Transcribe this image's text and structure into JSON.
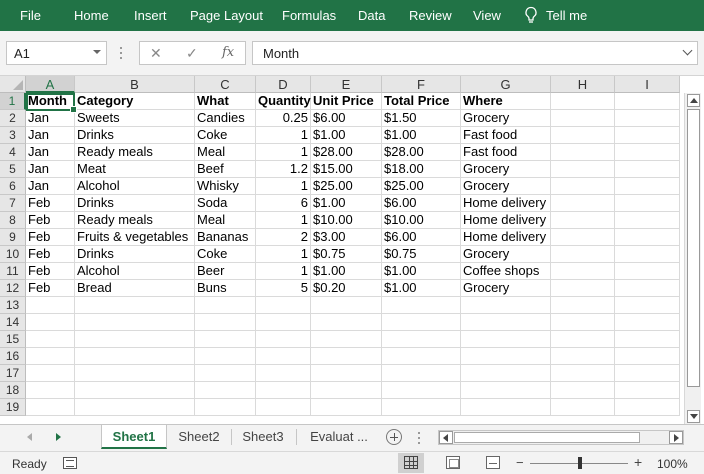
{
  "ribbon": {
    "tabs": [
      "File",
      "Home",
      "Insert",
      "Page Layout",
      "Formulas",
      "Data",
      "Review",
      "View"
    ],
    "tell_me": "Tell me",
    "color": "#217346"
  },
  "formula_bar": {
    "name_box": "A1",
    "cancel_icon": "✕",
    "enter_icon": "✓",
    "fx_label": "fx",
    "content": "Month"
  },
  "sheet": {
    "columns": [
      "A",
      "B",
      "C",
      "D",
      "E",
      "F",
      "G",
      "H",
      "I"
    ],
    "row_numbers": [
      "1",
      "2",
      "3",
      "4",
      "5",
      "6",
      "7",
      "8",
      "9",
      "10",
      "11",
      "12",
      "13",
      "14",
      "15",
      "16",
      "17",
      "18",
      "19"
    ],
    "header": [
      "Month",
      "Category",
      "What",
      "Quantity",
      "Unit Price",
      "Total Price",
      "Where"
    ],
    "rows": [
      [
        "Jan",
        "Sweets",
        "Candies",
        "0.25",
        "$6.00",
        "$1.50",
        "Grocery"
      ],
      [
        "Jan",
        "Drinks",
        "Coke",
        "1",
        "$1.00",
        "$1.00",
        "Fast food"
      ],
      [
        "Jan",
        "Ready meals",
        "Meal",
        "1",
        "$28.00",
        "$28.00",
        "Fast food"
      ],
      [
        "Jan",
        "Meat",
        "Beef",
        "1.2",
        "$15.00",
        "$18.00",
        "Grocery"
      ],
      [
        "Jan",
        "Alcohol",
        "Whisky",
        "1",
        "$25.00",
        "$25.00",
        "Grocery"
      ],
      [
        "Feb",
        "Drinks",
        "Soda",
        "6",
        "$1.00",
        "$6.00",
        "Home delivery"
      ],
      [
        "Feb",
        "Ready meals",
        "Meal",
        "1",
        "$10.00",
        "$10.00",
        "Home delivery"
      ],
      [
        "Feb",
        "Fruits & vegetables",
        "Bananas",
        "2",
        "$3.00",
        "$6.00",
        "Home delivery"
      ],
      [
        "Feb",
        "Drinks",
        "Coke",
        "1",
        "$0.75",
        "$0.75",
        "Grocery"
      ],
      [
        "Feb",
        "Alcohol",
        "Beer",
        "1",
        "$1.00",
        "$1.00",
        "Coffee shops"
      ],
      [
        "Feb",
        "Bread",
        "Buns",
        "5",
        "$0.20",
        "$1.00",
        "Grocery"
      ]
    ],
    "active_cell": "A1"
  },
  "sheet_tabs": {
    "tabs": [
      "Sheet1",
      "Sheet2",
      "Sheet3",
      "Evaluat ..."
    ],
    "active": "Sheet1"
  },
  "status_bar": {
    "status": "Ready",
    "zoom_minus": "−",
    "zoom_plus": "+",
    "zoom": "100%"
  }
}
